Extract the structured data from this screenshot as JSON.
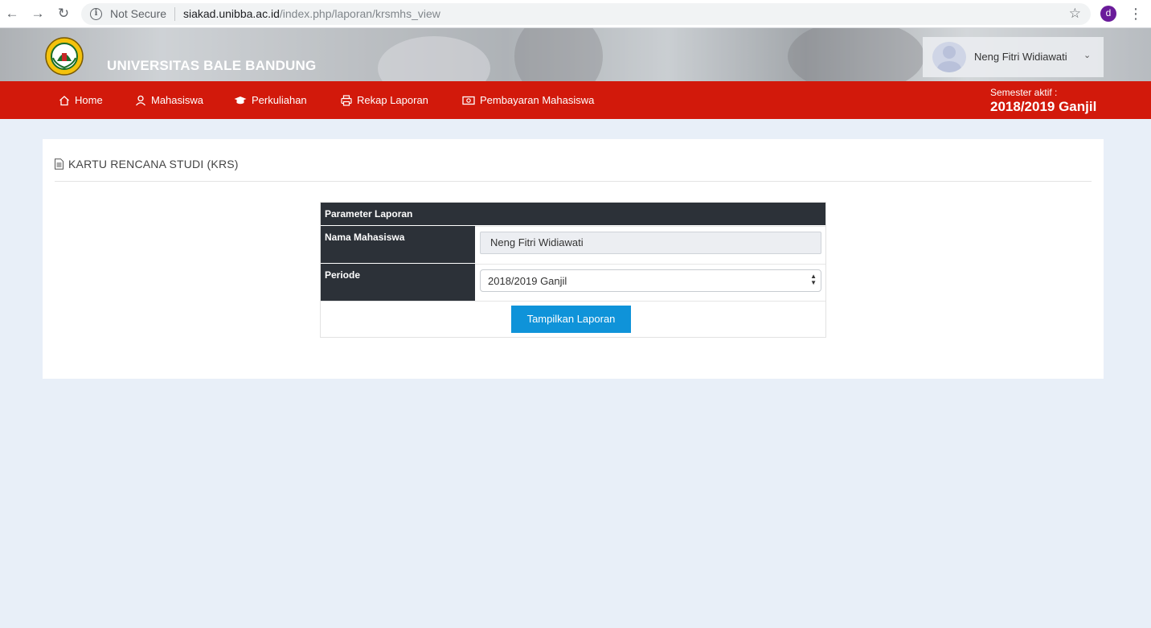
{
  "browser": {
    "not_secure": "Not Secure",
    "url_host": "siakad.unibba.ac.id",
    "url_path": "/index.php/laporan/krsmhs_view",
    "profile_initial": "d"
  },
  "header": {
    "site_title": "UNIVERSITAS BALE BANDUNG",
    "user_name": "Neng Fitri Widiawati"
  },
  "nav": {
    "items": [
      {
        "label": "Home",
        "icon": "home-icon"
      },
      {
        "label": "Mahasiswa",
        "icon": "user-icon"
      },
      {
        "label": "Perkuliahan",
        "icon": "graduation-cap-icon"
      },
      {
        "label": "Rekap Laporan",
        "icon": "printer-icon"
      },
      {
        "label": "Pembayaran Mahasiswa",
        "icon": "money-icon"
      }
    ],
    "semester_label": "Semester aktif :",
    "semester_value": "2018/2019 Ganjil"
  },
  "panel": {
    "title": "KARTU RENCANA STUDI (KRS)",
    "table_header": "Parameter Laporan",
    "name_label": "Nama Mahasiswa",
    "name_value": "Neng Fitri Widiawati",
    "period_label": "Periode",
    "period_value": "2018/2019 Ganjil",
    "submit_label": "Tampilkan Laporan"
  },
  "colors": {
    "nav_red": "#d2190b",
    "table_dark": "#2c3138",
    "button_blue": "#0f93d9",
    "page_bg": "#e8eff8"
  }
}
